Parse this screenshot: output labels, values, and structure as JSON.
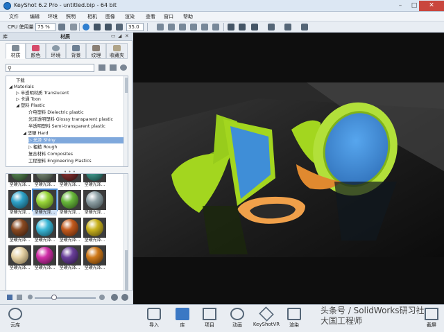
{
  "window": {
    "title": "KeyShot 6.2 Pro  -  untitled.bip  -  64 bit",
    "min": "–",
    "max": "□",
    "close": "✕"
  },
  "menu": [
    "文件",
    "编辑",
    "环境",
    "照明",
    "相机",
    "图像",
    "渲染",
    "查看",
    "窗口",
    "帮助"
  ],
  "toolbar": {
    "cpu_label": "CPU 使用量",
    "cpu_value": "75 %",
    "zoom_value": "35.0"
  },
  "panel": {
    "library_label": "库",
    "materials_label": "材质",
    "header_buttons": [
      "▭",
      "◢",
      "✕"
    ],
    "tabs": [
      {
        "label": "材质",
        "active": true,
        "color": "#7f8b96"
      },
      {
        "label": "颜色",
        "active": false,
        "color": "#d64b6a"
      },
      {
        "label": "环境",
        "active": false,
        "color": "#8a9aa7"
      },
      {
        "label": "背景",
        "active": false,
        "color": "#6c7f93"
      },
      {
        "label": "纹理",
        "active": false,
        "color": "#8a7f74"
      },
      {
        "label": "收藏夹",
        "active": false,
        "color": "#b0a488"
      }
    ],
    "search": {
      "value": "",
      "icon": "magnifier-icon"
    },
    "tree": [
      {
        "label": "下载",
        "indent": 0,
        "arrow": ""
      },
      {
        "label": "Materials",
        "indent": 0,
        "arrow": "◢"
      },
      {
        "label": "半透明材质 Translucent",
        "indent": 1,
        "arrow": "▷"
      },
      {
        "label": "卡通 Toon",
        "indent": 1,
        "arrow": "▷"
      },
      {
        "label": "塑料 Plastic",
        "indent": 1,
        "arrow": "◢"
      },
      {
        "label": "介电塑料 Dielectric plastic",
        "indent": 2,
        "arrow": ""
      },
      {
        "label": "光泽透明塑料 Glossy transparent plastic",
        "indent": 2,
        "arrow": ""
      },
      {
        "label": "半透明塑料 Semi-transparent plastic",
        "indent": 2,
        "arrow": ""
      },
      {
        "label": "坚硬 Hard",
        "indent": 2,
        "arrow": "◢"
      },
      {
        "label": "光泽 Shiny",
        "indent": 3,
        "arrow": "▷",
        "selected": true
      },
      {
        "label": "粗糙 Rough",
        "indent": 3,
        "arrow": "▷"
      },
      {
        "label": "复合材料 Composites",
        "indent": 1,
        "arrow": ""
      },
      {
        "label": "工程塑料 Engineering Plastics",
        "indent": 1,
        "arrow": ""
      }
    ],
    "splitter": "• • •",
    "swatch_label": "坚硬光泽...",
    "swatches": [
      {
        "color": "#4f7a4b",
        "selected": false
      },
      {
        "color": "#6d7d6a",
        "selected": false
      },
      {
        "color": "#7b2d2d",
        "selected": false
      },
      {
        "color": "#3a8f84",
        "selected": false
      },
      {
        "color": "#2fa3c9",
        "selected": false
      },
      {
        "color": "#9ad73a",
        "selected": true
      },
      {
        "color": "#69b83b",
        "selected": false
      },
      {
        "color": "#8fa1a6",
        "selected": false
      },
      {
        "color": "#8a4a22",
        "selected": false
      },
      {
        "color": "#3bb7d6",
        "selected": false
      },
      {
        "color": "#c35a1d",
        "selected": false
      },
      {
        "color": "#c9b21e",
        "selected": false
      },
      {
        "color": "#e7d3a7",
        "selected": false
      },
      {
        "color": "#d12fa8",
        "selected": false
      },
      {
        "color": "#6a3f9a",
        "selected": false
      },
      {
        "color": "#d07a19",
        "selected": false
      }
    ]
  },
  "scene": {
    "bg": "#141414",
    "green": "#a3d61f",
    "blue": "#3f8ed7",
    "orange": "#f0a04a"
  },
  "bottombar": [
    {
      "label": "云库",
      "icon": "cloud-library-icon"
    },
    {
      "label": "导入",
      "icon": "import-icon"
    },
    {
      "label": "库",
      "icon": "book-icon"
    },
    {
      "label": "项目",
      "icon": "project-icon"
    },
    {
      "label": "动画",
      "icon": "animation-play-icon"
    },
    {
      "label": "KeyShotVR",
      "icon": "cube-icon"
    },
    {
      "label": "渲染",
      "icon": "render-icon"
    }
  ],
  "watermark": {
    "line1": "头条号 / SolidWorks研习社",
    "line2": "大国工程师"
  },
  "bottom_right_label": "截屏"
}
